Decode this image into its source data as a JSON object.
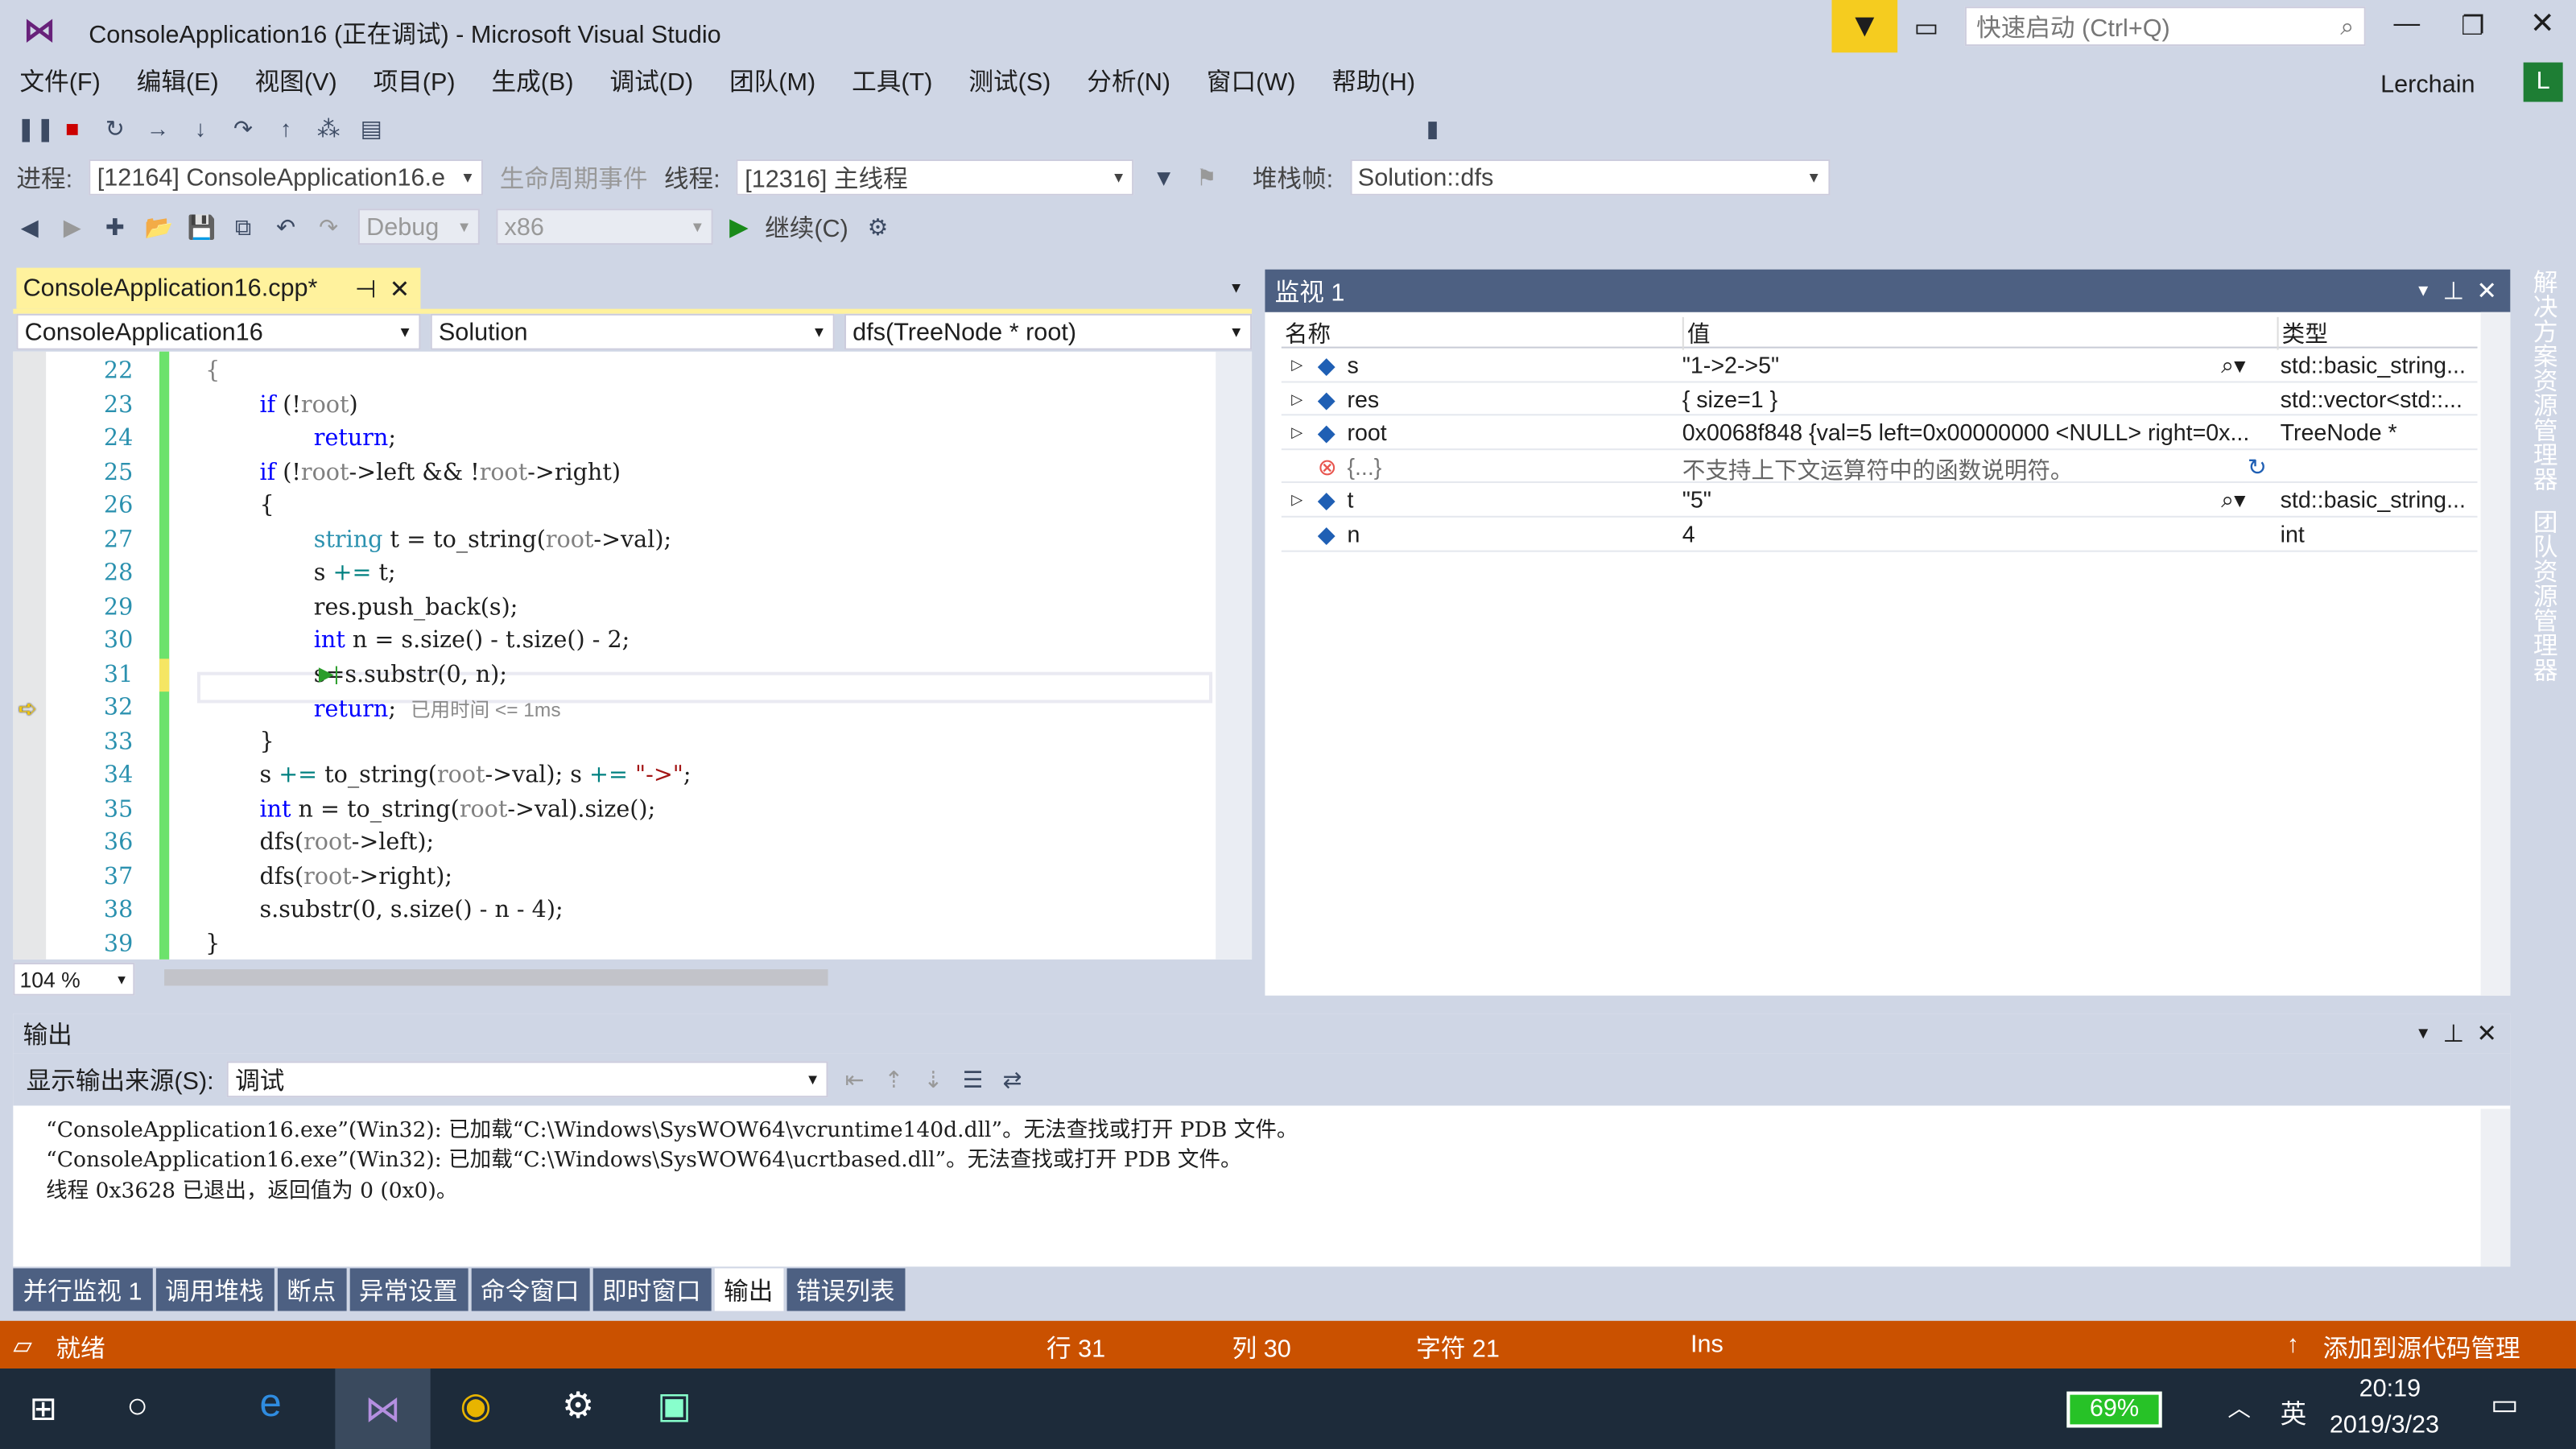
{
  "window": {
    "title": "ConsoleApplication16 (正在调试) - Microsoft Visual Studio",
    "quick_launch_placeholder": "快速启动 (Ctrl+Q)",
    "user": "Lerchain",
    "user_initial": "L"
  },
  "menu": [
    "文件(F)",
    "编辑(E)",
    "视图(V)",
    "项目(P)",
    "生成(B)",
    "调试(D)",
    "团队(M)",
    "工具(T)",
    "测试(S)",
    "分析(N)",
    "窗口(W)",
    "帮助(H)"
  ],
  "debug_bar": {
    "process_label": "进程:",
    "process_value": "[12164] ConsoleApplication16.e",
    "lifecycle_label": "生命周期事件",
    "thread_label": "线程:",
    "thread_value": "[12316] 主线程",
    "stack_label": "堆栈帧:",
    "stack_value": "Solution::dfs"
  },
  "std_bar": {
    "config": "Debug",
    "platform": "x86",
    "continue": "继续(C)"
  },
  "editor": {
    "tab": "ConsoleApplication16.cpp*",
    "nav_project": "ConsoleApplication16",
    "nav_class": "Solution",
    "nav_member": "dfs(TreeNode * root)",
    "zoom": "104 %",
    "current_line": 31,
    "next_line": 32,
    "lines": [
      {
        "n": "22",
        "i": 1,
        "tokens": [
          [
            "{",
            "p"
          ]
        ]
      },
      {
        "n": "23",
        "i": 2,
        "tokens": [
          [
            "if",
            "k"
          ],
          [
            " (!",
            ""
          ],
          [
            "root",
            "p"
          ],
          [
            ")",
            ""
          ]
        ]
      },
      {
        "n": "24",
        "i": 3,
        "tokens": [
          [
            "return",
            "k"
          ],
          [
            ";",
            ""
          ]
        ]
      },
      {
        "n": "25",
        "i": 2,
        "tokens": [
          [
            "if",
            "k"
          ],
          [
            " (!",
            ""
          ],
          [
            "root",
            "p"
          ],
          [
            "->left && !",
            ""
          ],
          [
            "root",
            "p"
          ],
          [
            "->right)",
            ""
          ]
        ]
      },
      {
        "n": "26",
        "i": 2,
        "tokens": [
          [
            "{",
            ""
          ]
        ]
      },
      {
        "n": "27",
        "i": 3,
        "tokens": [
          [
            "string",
            "t"
          ],
          [
            " t = to_string(",
            ""
          ],
          [
            "root",
            "p"
          ],
          [
            "->val);",
            ""
          ]
        ]
      },
      {
        "n": "28",
        "i": 3,
        "tokens": [
          [
            "s ",
            ""
          ],
          [
            "+=",
            "o"
          ],
          [
            " t;",
            ""
          ]
        ]
      },
      {
        "n": "29",
        "i": 3,
        "tokens": [
          [
            "res.push_back(s);",
            ""
          ]
        ]
      },
      {
        "n": "30",
        "i": 3,
        "tokens": [
          [
            "int",
            "k"
          ],
          [
            " n = s.size() - t.size() - 2;",
            ""
          ]
        ]
      },
      {
        "n": "31",
        "i": 3,
        "tokens": [
          [
            "s=s.substr(0, n);",
            ""
          ]
        ]
      },
      {
        "n": "32",
        "i": 3,
        "tokens": [
          [
            "return",
            "k"
          ],
          [
            ";  ",
            ""
          ],
          [
            "已用时间 <= 1ms",
            "g"
          ]
        ]
      },
      {
        "n": "33",
        "i": 2,
        "tokens": [
          [
            "}",
            ""
          ]
        ]
      },
      {
        "n": "34",
        "i": 2,
        "tokens": [
          [
            "s ",
            ""
          ],
          [
            "+=",
            "o"
          ],
          [
            " to_string(",
            ""
          ],
          [
            "root",
            "p"
          ],
          [
            "->val); s ",
            ""
          ],
          [
            "+=",
            "o"
          ],
          [
            " ",
            ""
          ],
          [
            "\"->\"",
            "s"
          ],
          [
            ";",
            ""
          ]
        ]
      },
      {
        "n": "35",
        "i": 2,
        "tokens": [
          [
            "int",
            "k"
          ],
          [
            " n = to_string(",
            ""
          ],
          [
            "root",
            "p"
          ],
          [
            "->val).size();",
            ""
          ]
        ]
      },
      {
        "n": "36",
        "i": 2,
        "tokens": [
          [
            "dfs(",
            ""
          ],
          [
            "root",
            "p"
          ],
          [
            "->left);",
            ""
          ]
        ]
      },
      {
        "n": "37",
        "i": 2,
        "tokens": [
          [
            "dfs(",
            ""
          ],
          [
            "root",
            "p"
          ],
          [
            "->right);",
            ""
          ]
        ]
      },
      {
        "n": "38",
        "i": 2,
        "tokens": [
          [
            "s.substr(0, s.size() - n - 4);",
            ""
          ]
        ]
      },
      {
        "n": "39",
        "i": 1,
        "tokens": [
          [
            "}",
            ""
          ]
        ]
      }
    ]
  },
  "watch": {
    "title": "监视 1",
    "columns": [
      "名称",
      "值",
      "类型"
    ],
    "rows": [
      {
        "name": "s",
        "value": "\"1->2->5\"",
        "type": "std::basic_string...",
        "expand": true,
        "icon": "field-icon"
      },
      {
        "name": "res",
        "value": "{ size=1 }",
        "type": "std::vector<std::...",
        "expand": true,
        "icon": "field-icon"
      },
      {
        "name": "root",
        "value": "0x0068f848 {val=5 left=0x00000000 <NULL> right=0x...",
        "type": "TreeNode *",
        "expand": true,
        "icon": "field-icon"
      },
      {
        "name": "{...}",
        "value": "不支持上下文运算符中的函数说明符。",
        "type": "",
        "expand": false,
        "icon": "error-icon"
      },
      {
        "name": "t",
        "value": "\"5\"",
        "type": "std::basic_string...",
        "expand": true,
        "icon": "field-icon"
      },
      {
        "name": "n",
        "value": "4",
        "type": "int",
        "expand": false,
        "icon": "field-icon"
      }
    ]
  },
  "side_tabs": [
    "解决方案资源管理器",
    "团队资源管理器"
  ],
  "output": {
    "title": "输出",
    "source_label": "显示输出来源(S):",
    "source_value": "调试",
    "lines": [
      "“ConsoleApplication16.exe”(Win32): 已加载“C:\\Windows\\SysWOW64\\vcruntime140d.dll”。无法查找或打开 PDB 文件。",
      "“ConsoleApplication16.exe”(Win32): 已加载“C:\\Windows\\SysWOW64\\ucrtbased.dll”。无法查找或打开 PDB 文件。",
      "线程 0x3628 已退出，返回值为 0 (0x0)。"
    ]
  },
  "bottom_tabs": [
    {
      "label": "并行监视 1"
    },
    {
      "label": "调用堆栈"
    },
    {
      "label": "断点"
    },
    {
      "label": "异常设置"
    },
    {
      "label": "命令窗口"
    },
    {
      "label": "即时窗口"
    },
    {
      "label": "输出",
      "active": true
    },
    {
      "label": "错误列表"
    }
  ],
  "status": {
    "ready": "就绪",
    "line": "行 31",
    "col": "列 30",
    "char": "字符 21",
    "mode": "Ins",
    "source_control": "添加到源代码管理"
  },
  "taskbar": {
    "battery": "69%",
    "ime": "英",
    "time": "20:19",
    "date": "2019/3/23"
  },
  "colors": {
    "status_bar": "#ca5100",
    "tool_header": "#4d6082",
    "active_tab": "#fff29d",
    "change_bar": "#6ce26c"
  }
}
